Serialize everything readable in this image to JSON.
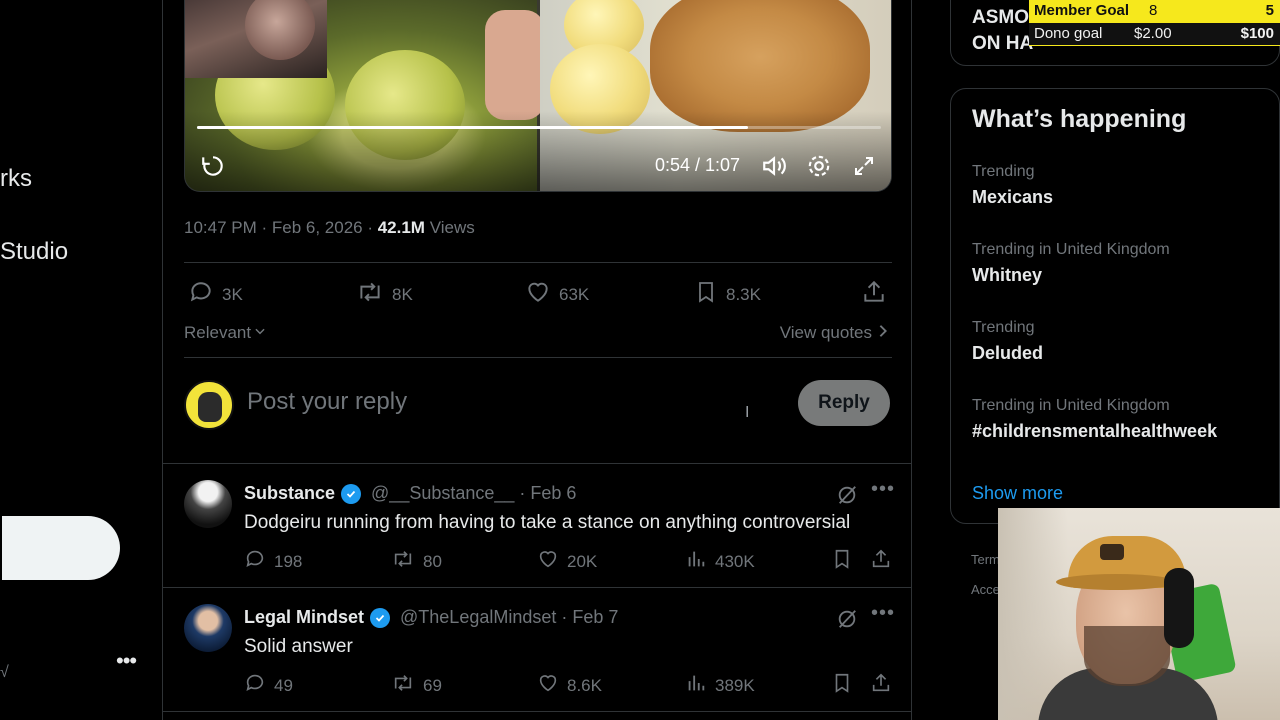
{
  "left_nav": {
    "item_partial_1": "rks",
    "item_partial_2": "Studio",
    "more_glyph": "•••",
    "edge_glyph": "√"
  },
  "video": {
    "time": "0:54 / 1:07",
    "progress": 0.805,
    "icons": [
      "replay-icon",
      "volume-icon",
      "settings-icon",
      "fullscreen-icon"
    ]
  },
  "tweet": {
    "timestamp": "10:47 PM · Feb 6, 2026 · ",
    "views_count": "42.1M",
    "views_label": " Views",
    "stats": {
      "replies": "3K",
      "reposts": "8K",
      "likes": "63K",
      "bookmarks": "8.3K"
    },
    "sort_label": "Relevant",
    "view_quotes": "View quotes"
  },
  "composer": {
    "placeholder": "Post your reply",
    "reply_button": "Reply",
    "cursor_glyph": "I"
  },
  "replies": [
    {
      "name": "Substance",
      "handle": "@__Substance__ · Feb 6",
      "text": "Dodgeiru running from having to take a stance on anything controversial",
      "replies": "198",
      "reposts": "80",
      "likes": "20K",
      "views": "430K"
    },
    {
      "name": "Legal Mindset",
      "handle": "@TheLegalMindset · Feb 7",
      "text": "Solid answer",
      "replies": "49",
      "reposts": "69",
      "likes": "8.6K",
      "views": "389K"
    }
  ],
  "right": {
    "top_card_line1": "ASMO",
    "top_card_line2": "ON HA",
    "happening_title": "What’s happening",
    "trends": [
      {
        "context": "Trending",
        "topic": "Mexicans"
      },
      {
        "context": "Trending in United Kingdom",
        "topic": "Whitney"
      },
      {
        "context": "Trending",
        "topic": "Deluded"
      },
      {
        "context": "Trending in United Kingdom",
        "topic": "#childrensmentalhealthweek"
      }
    ],
    "show_more": "Show more",
    "footer_1": "Term",
    "footer_2": "Acce"
  },
  "stream_overlay": {
    "member_goal_label": "Member Goal",
    "member_goal_current": "8",
    "member_goal_target": "5",
    "dono_goal_label": "Dono goal",
    "dono_goal_current": "$2.00",
    "dono_goal_target": "$100"
  },
  "colors": {
    "accent": "#1d9bf0",
    "background": "#000000",
    "border": "#2f3336",
    "muted_text": "#71767b",
    "overlay_yellow": "#f6e81c"
  }
}
